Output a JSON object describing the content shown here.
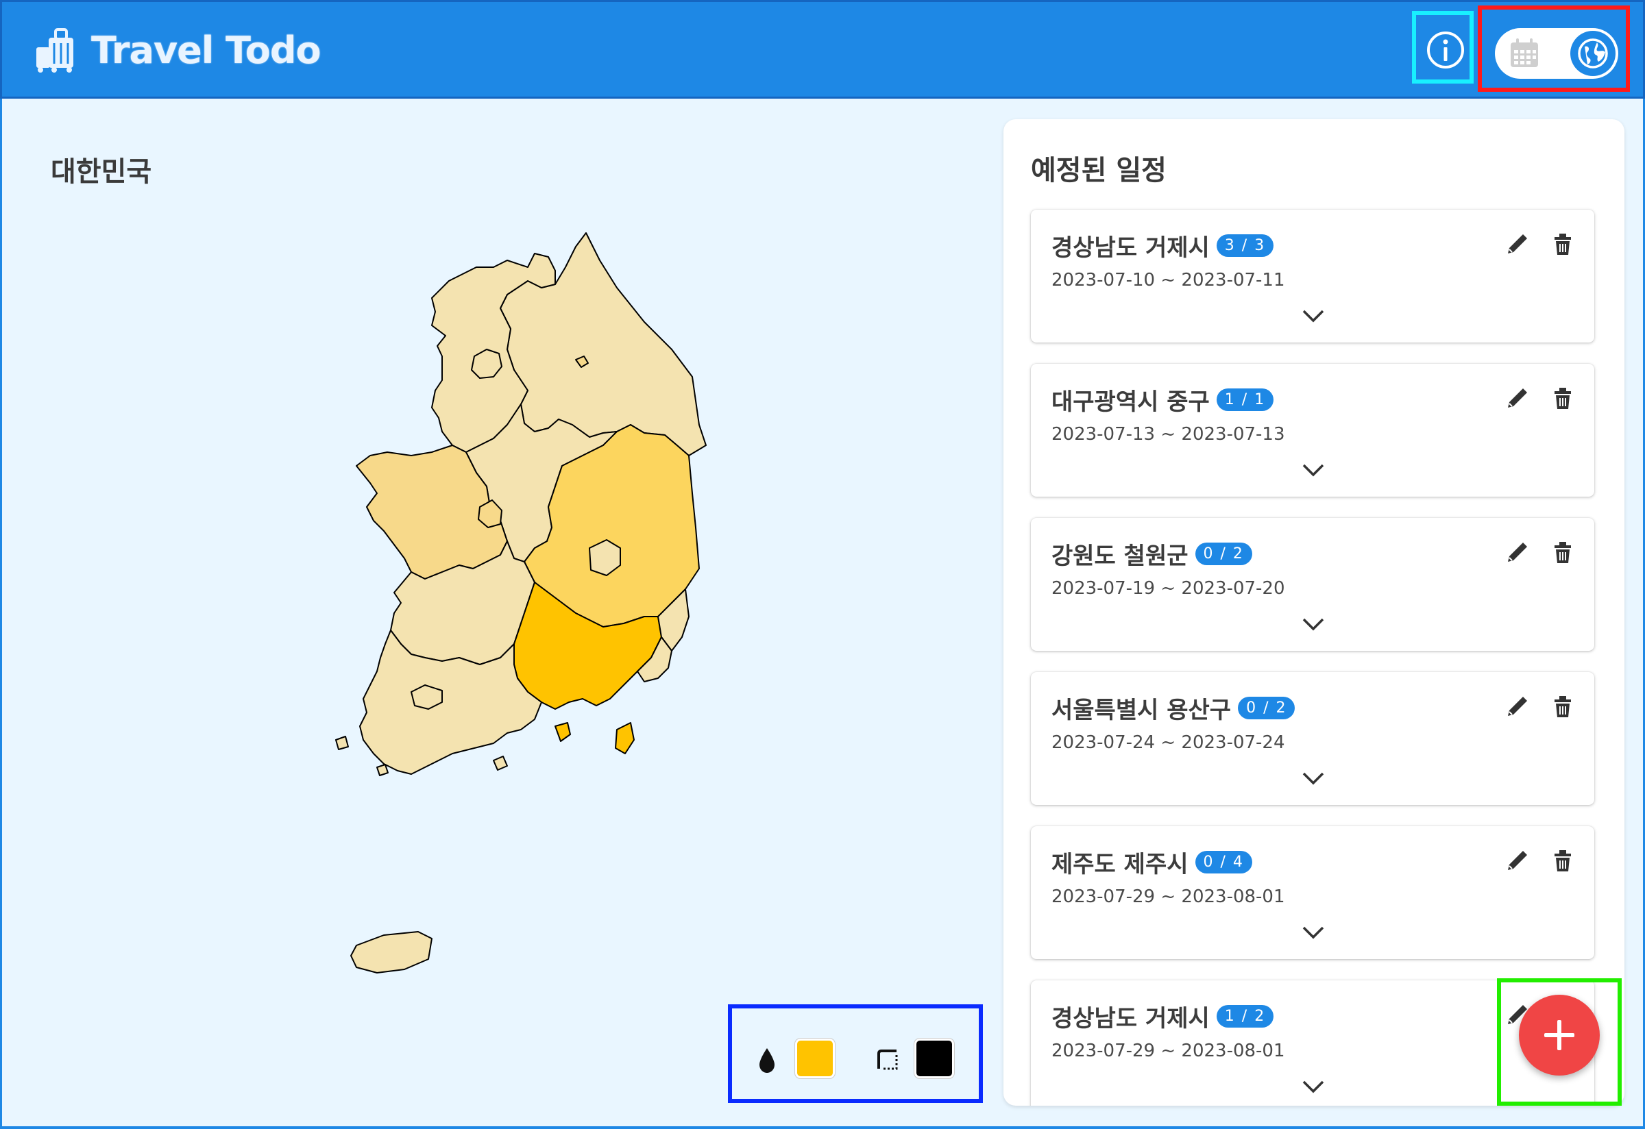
{
  "app": {
    "title": "Travel Todo",
    "country": "대한민국"
  },
  "header": {
    "info_icon": "info-icon",
    "view_toggle": {
      "left_icon": "calendar-icon",
      "right_icon": "globe-icon",
      "active": "map"
    }
  },
  "map": {
    "fill_color": "#ffc300",
    "border_color": "#000000"
  },
  "schedule": {
    "title": "예정된 일정",
    "items": [
      {
        "name": "경상남도 거제시",
        "progress": "3 / 3",
        "dates": "2023-07-10 ~ 2023-07-11"
      },
      {
        "name": "대구광역시 중구",
        "progress": "1 / 1",
        "dates": "2023-07-13 ~ 2023-07-13"
      },
      {
        "name": "강원도 철원군",
        "progress": "0 / 2",
        "dates": "2023-07-19 ~ 2023-07-20"
      },
      {
        "name": "서울특별시 용산구",
        "progress": "0 / 2",
        "dates": "2023-07-24 ~ 2023-07-24"
      },
      {
        "name": "제주도 제주시",
        "progress": "0 / 4",
        "dates": "2023-07-29 ~ 2023-08-01"
      },
      {
        "name": "경상남도 거제시",
        "progress": "1 / 2",
        "dates": "2023-07-29 ~ 2023-08-01"
      }
    ]
  },
  "colors": {
    "header_bg": "#1e88e5",
    "panel_bg": "#e9f6ff",
    "fab": "#f04545"
  }
}
